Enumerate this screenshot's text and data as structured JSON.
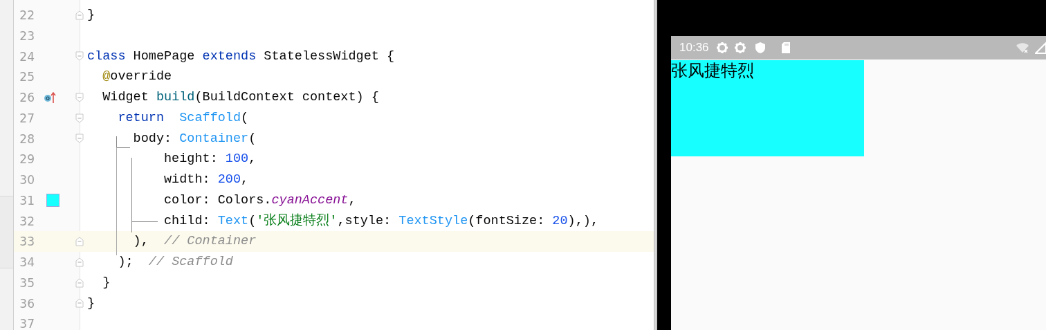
{
  "editor": {
    "lines": [
      {
        "number": "22",
        "fold_start": false,
        "fold_end": true,
        "override_marker": false,
        "current": false,
        "tokens": [
          {
            "kind": "plain",
            "text": "}"
          }
        ]
      },
      {
        "number": "23",
        "fold_start": false,
        "fold_end": false,
        "override_marker": false,
        "current": false
      },
      {
        "number": "24",
        "fold_start": true,
        "fold_end": false,
        "override_marker": false,
        "current": false,
        "tokens": [
          {
            "kind": "keyword",
            "text": "class"
          },
          {
            "kind": "plain",
            "text": " HomePage "
          },
          {
            "kind": "keyword",
            "text": "extends"
          },
          {
            "kind": "plain",
            "text": " StatelessWidget {"
          }
        ]
      },
      {
        "number": "25",
        "fold_start": false,
        "fold_end": false,
        "override_marker": false,
        "current": false,
        "tokens": [
          {
            "kind": "annotation",
            "text": "  @"
          },
          {
            "kind": "plain",
            "text": "override"
          }
        ]
      },
      {
        "number": "26",
        "fold_start": true,
        "fold_end": false,
        "override_marker": true,
        "current": false,
        "tokens": [
          {
            "kind": "plain",
            "text": "  Widget "
          },
          {
            "kind": "method",
            "text": "build"
          },
          {
            "kind": "plain",
            "text": "(BuildContext context) {"
          }
        ]
      },
      {
        "number": "27",
        "fold_start": true,
        "fold_end": false,
        "override_marker": false,
        "current": false,
        "tokens": [
          {
            "kind": "keyword",
            "text": "    return"
          },
          {
            "kind": "type",
            "text": "  Scaffold"
          },
          {
            "kind": "plain",
            "text": "("
          }
        ]
      },
      {
        "number": "28",
        "fold_start": true,
        "fold_end": false,
        "override_marker": false,
        "current": false,
        "tokens": [
          {
            "kind": "plain",
            "text": "      body: "
          },
          {
            "kind": "type",
            "text": "Container"
          },
          {
            "kind": "plain",
            "text": "("
          }
        ]
      },
      {
        "number": "29",
        "fold_start": false,
        "fold_end": false,
        "override_marker": false,
        "current": false,
        "tokens": [
          {
            "kind": "plain",
            "text": "          height: "
          },
          {
            "kind": "number",
            "text": "100"
          },
          {
            "kind": "plain",
            "text": ","
          }
        ]
      },
      {
        "number": "30",
        "fold_start": false,
        "fold_end": false,
        "override_marker": false,
        "current": false,
        "tokens": [
          {
            "kind": "plain",
            "text": "          width: "
          },
          {
            "kind": "number",
            "text": "200"
          },
          {
            "kind": "plain",
            "text": ","
          }
        ]
      },
      {
        "number": "31",
        "fold_start": false,
        "fold_end": false,
        "override_marker": false,
        "current": false,
        "color": "#18ffff",
        "tokens": [
          {
            "kind": "plain",
            "text": "          color: Colors."
          },
          {
            "kind": "field",
            "text": "cyanAccent"
          },
          {
            "kind": "plain",
            "text": ","
          }
        ]
      },
      {
        "number": "32",
        "fold_start": false,
        "fold_end": false,
        "override_marker": false,
        "current": false,
        "tokens": [
          {
            "kind": "plain",
            "text": "          child: "
          },
          {
            "kind": "type",
            "text": "Text"
          },
          {
            "kind": "plain",
            "text": "("
          },
          {
            "kind": "string",
            "text": "'张风捷特烈'"
          },
          {
            "kind": "plain",
            "text": ",style: "
          },
          {
            "kind": "type",
            "text": "TextStyle"
          },
          {
            "kind": "plain",
            "text": "(fontSize: "
          },
          {
            "kind": "number",
            "text": "20"
          },
          {
            "kind": "plain",
            "text": "),),"
          }
        ]
      },
      {
        "number": "33",
        "fold_start": false,
        "fold_end": true,
        "override_marker": false,
        "current": true,
        "tokens": [
          {
            "kind": "plain",
            "text": "      ),  "
          },
          {
            "kind": "comment",
            "text": "// Container"
          }
        ]
      },
      {
        "number": "34",
        "fold_start": false,
        "fold_end": true,
        "override_marker": false,
        "current": false,
        "tokens": [
          {
            "kind": "plain",
            "text": "    );  "
          },
          {
            "kind": "comment",
            "text": "// Scaffold"
          }
        ]
      },
      {
        "number": "35",
        "fold_start": false,
        "fold_end": true,
        "override_marker": false,
        "current": false,
        "tokens": [
          {
            "kind": "plain",
            "text": "  }"
          }
        ]
      },
      {
        "number": "36",
        "fold_start": false,
        "fold_end": true,
        "override_marker": false,
        "current": false,
        "tokens": [
          {
            "kind": "plain",
            "text": "}"
          }
        ]
      },
      {
        "number": "37",
        "fold_start": false,
        "fold_end": false,
        "override_marker": false,
        "current": false
      }
    ]
  },
  "emulator": {
    "status_bar": {
      "time": "10:36"
    },
    "app": {
      "color": "#18ffff",
      "text": "张风捷特烈"
    }
  }
}
